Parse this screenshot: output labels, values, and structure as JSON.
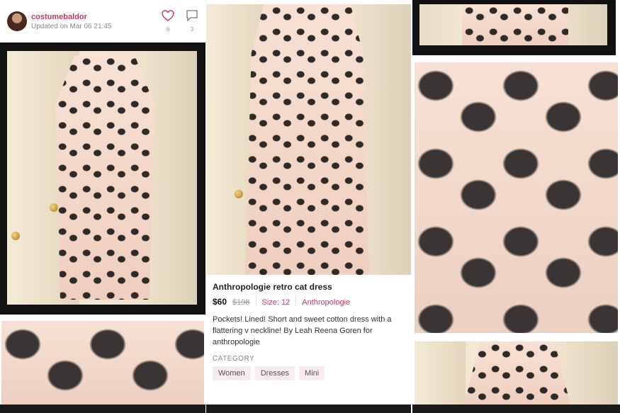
{
  "header": {
    "username": "costumebaldor",
    "updated": "Updated on Mar 06 21:45",
    "like_count": "6",
    "comment_count": "3"
  },
  "listing": {
    "title": "Anthropologie retro cat dress",
    "price": "$60",
    "original_price": "$198",
    "size": "Size: 12",
    "brand": "Anthropologie",
    "description": "Pockets! Lined! Short and sweet cotton dress with a flattering v neckline! By Leah Reena Goren  for anthropologie",
    "category_label": "CATEGORY",
    "categories": [
      "Women",
      "Dresses",
      "Mini"
    ]
  },
  "icons": {
    "like": "heart-icon",
    "comment": "comment-icon"
  },
  "colors": {
    "accent": "#c2395a",
    "tag_bg": "#f8ecec"
  }
}
